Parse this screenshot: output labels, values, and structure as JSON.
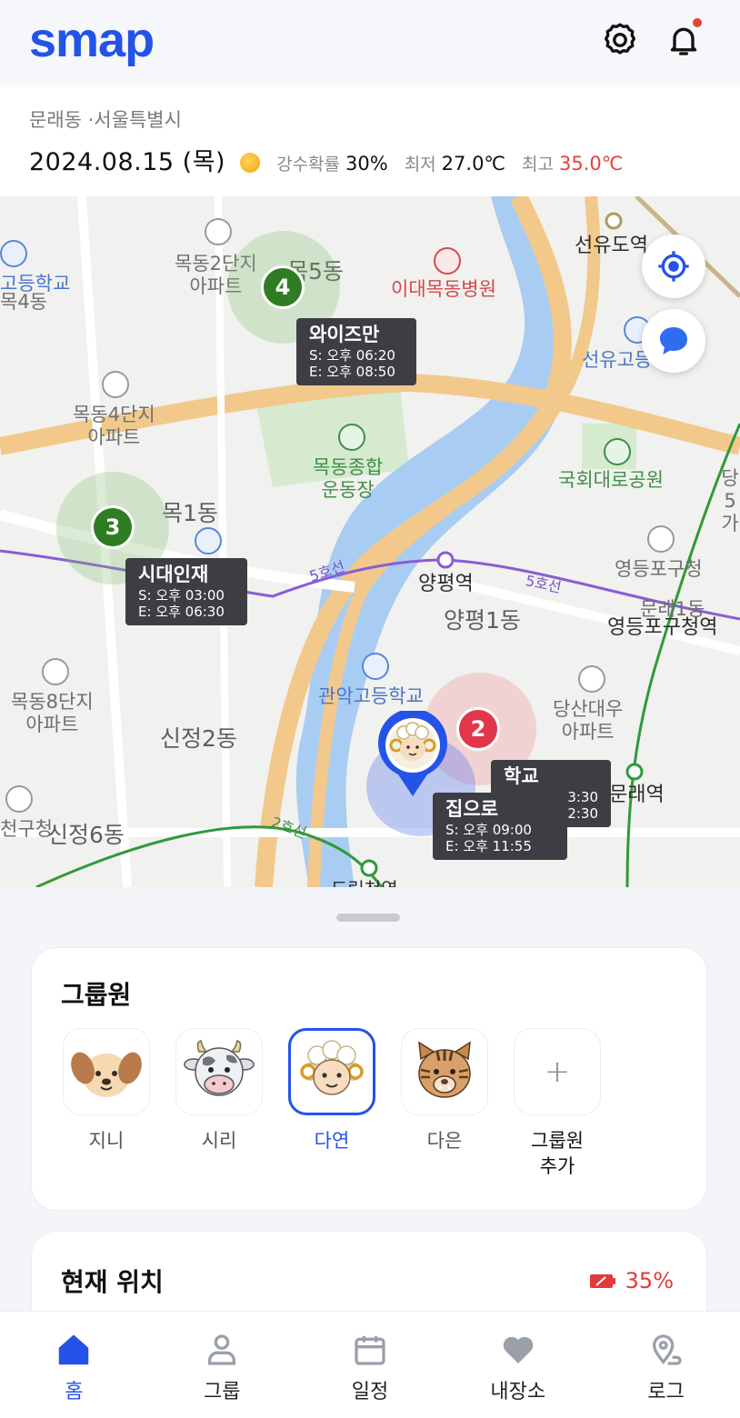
{
  "header": {
    "logo": "smap",
    "has_notification": true
  },
  "info": {
    "location": "문래동 ·서울특별시",
    "date": "2024.08.15 (목)",
    "weather_icon": "sun-icon",
    "rain_label": "강수확률",
    "rain_value": "30%",
    "min_label": "최저",
    "min_value": "27.0℃",
    "max_label": "최고",
    "max_value": "35.0℃"
  },
  "map": {
    "labels": {
      "mokdong2": "목동2단지\n아파트",
      "mok5dong": "목5동",
      "idae_hospital": "이대목동병원",
      "seonyudo": "선유도역",
      "seonyu_high": "선유고등",
      "godeung_school": "고등학교",
      "mok4": "목4동",
      "mokdong4": "목동4단지\n아파트",
      "mokdong_stadium": "목동종합\n운동장",
      "national_park": "국회대로공원",
      "mok1dong": "목1동",
      "line5_a": "5호선",
      "line5_b": "5호선",
      "yangpyeong_station": "양평역",
      "yangpyeong1": "양평1동",
      "yeongdeungpo_office": "영등포구청",
      "yeongdeungpo_station": "영등포구청역",
      "mullae1": "문래1동",
      "mokdong8": "목동8단지\n아파트",
      "gwanak_high": "관악고등학교",
      "sinjeong2": "신정2동",
      "dangsan_apt": "당산대우\n아파트",
      "mullae_station": "문래역",
      "gucheong": "천구청",
      "sinjeong6": "신정6동",
      "line2": "2호선",
      "dorim": "도림천역",
      "edge_right": "당\n5가"
    },
    "clusters": [
      {
        "count": "4",
        "color": "#2f7d22"
      },
      {
        "count": "3",
        "color": "#2f7d22"
      },
      {
        "count": "2",
        "color": "#e2364a"
      }
    ],
    "tooltips": [
      {
        "title": "와이즈만",
        "start": "S: 오후 06:20",
        "end": "E: 오후 08:50"
      },
      {
        "title": "시대인재",
        "start": "S: 오후 03:00",
        "end": "E: 오후 06:30"
      },
      {
        "title": "학교",
        "start": "3:30",
        "end": "2:30"
      },
      {
        "title": "집으로",
        "start": "S: 오후 09:00",
        "end": "E: 오후 11:55"
      }
    ]
  },
  "members_card": {
    "title": "그룹원",
    "members": [
      {
        "name": "지니",
        "icon": "dog-avatar-icon",
        "selected": false
      },
      {
        "name": "시리",
        "icon": "cow-avatar-icon",
        "selected": false
      },
      {
        "name": "다연",
        "icon": "sheep-avatar-icon",
        "selected": true
      },
      {
        "name": "다은",
        "icon": "tiger-avatar-icon",
        "selected": false
      }
    ],
    "add_label": "그룹원\n추가",
    "add_icon": "+"
  },
  "location_card": {
    "title": "현재 위치",
    "battery": "35%"
  },
  "nav": {
    "items": [
      {
        "label": "홈",
        "active": true
      },
      {
        "label": "그룹",
        "active": false
      },
      {
        "label": "일정",
        "active": false
      },
      {
        "label": "내장소",
        "active": false
      },
      {
        "label": "로그",
        "active": false
      }
    ]
  },
  "colors": {
    "brand": "#2453e8",
    "danger": "#e2453c",
    "cluster_green": "#2f7d22",
    "cluster_red": "#e2364a"
  }
}
